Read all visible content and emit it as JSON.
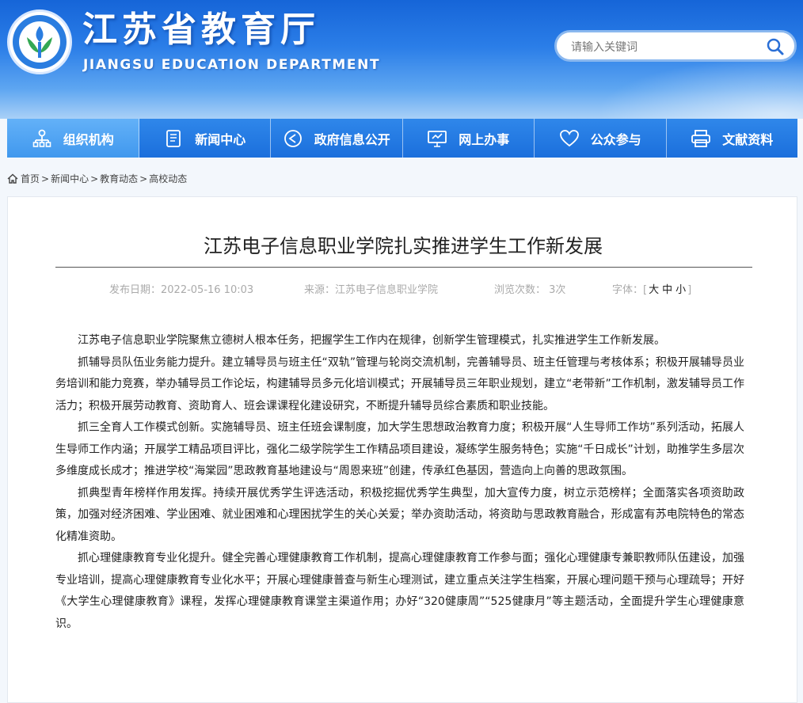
{
  "header": {
    "title": "江苏省教育厅",
    "subtitle": "JIANGSU EDUCATION DEPARTMENT",
    "search_placeholder": "请输入关键词"
  },
  "nav": {
    "items": [
      {
        "label": "组织机构",
        "icon": "org-chart-icon",
        "active": true
      },
      {
        "label": "新闻中心",
        "icon": "document-icon"
      },
      {
        "label": "政府信息公开",
        "icon": "share-icon"
      },
      {
        "label": "网上办事",
        "icon": "monitor-icon"
      },
      {
        "label": "公众参与",
        "icon": "heart-icon"
      },
      {
        "label": "文献资料",
        "icon": "printer-icon"
      }
    ]
  },
  "breadcrumb": {
    "items": [
      "首页",
      "新闻中心",
      "教育动态",
      "高校动态"
    ]
  },
  "article": {
    "title": "江苏电子信息职业学院扎实推进学生工作新发展",
    "publish": "发布日期：2022-05-16 10:03",
    "source": "来源：江苏电子信息职业学院",
    "views": "浏览次数： 3次",
    "font_label": "字体：",
    "font_sizes": [
      "大",
      "中",
      "小"
    ],
    "paragraphs": [
      "江苏电子信息职业学院聚焦立德树人根本任务，把握学生工作内在规律，创新学生管理模式，扎实推进学生工作新发展。",
      "抓辅导员队伍业务能力提升。建立辅导员与班主任“双轨”管理与轮岗交流机制，完善辅导员、班主任管理与考核体系；积极开展辅导员业务培训和能力竞赛，举办辅导员工作论坛，构建辅导员多元化培训模式；开展辅导员三年职业规划，建立“老带新”工作机制，激发辅导员工作活力；积极开展劳动教育、资助育人、班会课课程化建设研究，不断提升辅导员综合素质和职业技能。",
      "抓三全育人工作模式创新。实施辅导员、班主任班会课制度，加大学生思想政治教育力度；积极开展“人生导师工作坊”系列活动，拓展人生导师工作内涵；开展学工精品项目评比，强化二级学院学生工作精品项目建设，凝练学生服务特色；实施“千日成长”计划，助推学生多层次多维度成长成才；推进学校“海棠园”思政教育基地建设与“周恩来班”创建，传承红色基因，营造向上向善的思政氛围。",
      "抓典型青年榜样作用发挥。持续开展优秀学生评选活动，积极挖掘优秀学生典型，加大宣传力度，树立示范榜样；全面落实各项资助政策，加强对经济困难、学业困难、就业困难和心理困扰学生的关心关爱；举办资助活动，将资助与思政教育融合，形成富有苏电院特色的常态化精准资助。",
      "抓心理健康教育专业化提升。健全完善心理健康教育工作机制，提高心理健康教育工作参与面；强化心理健康专兼职教师队伍建设，加强专业培训，提高心理健康教育专业化水平；开展心理健康普查与新生心理测试，建立重点关注学生档案，开展心理问题干预与心理疏导；开好《大学生心理健康教育》课程，发挥心理健康教育课堂主渠道作用；办好“320健康周”“525健康月”等主题活动，全面提升学生心理健康意识。"
    ]
  }
}
